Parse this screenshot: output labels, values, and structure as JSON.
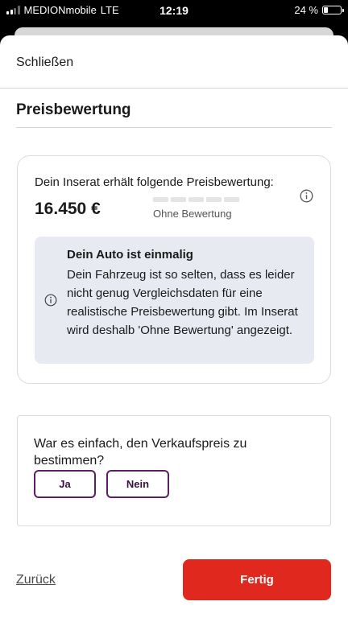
{
  "status_bar": {
    "carrier": "MEDIONmobile",
    "network": "LTE",
    "time": "12:19",
    "battery": "24 %",
    "battery_level": 0.24
  },
  "header": {
    "close_label": "Schließen"
  },
  "page": {
    "title": "Preisbewertung"
  },
  "price_card": {
    "intro": "Dein Inserat erhält folgende Preisbewertung:",
    "price": "16.450 €",
    "rating_label": "Ohne Bewertung",
    "info_icon": "info-icon",
    "info_box": {
      "heading": "Dein Auto ist einmalig",
      "text": "Dein Fahrzeug ist so selten, dass es leider nicht genug Vergleichsdaten für eine realistische Preisbewertung gibt. Im Inserat wird deshalb 'Ohne Bewertung' angezeigt."
    }
  },
  "feedback_card": {
    "question": "War es einfach, den Verkaufspreis zu bestimmen?",
    "yes_label": "Ja",
    "no_label": "Nein"
  },
  "footer": {
    "back_label": "Zurück",
    "done_label": "Fertig"
  },
  "colors": {
    "accent": "#e0281f",
    "option_border": "#5a1f5e",
    "info_bg": "#e7ebf1"
  }
}
